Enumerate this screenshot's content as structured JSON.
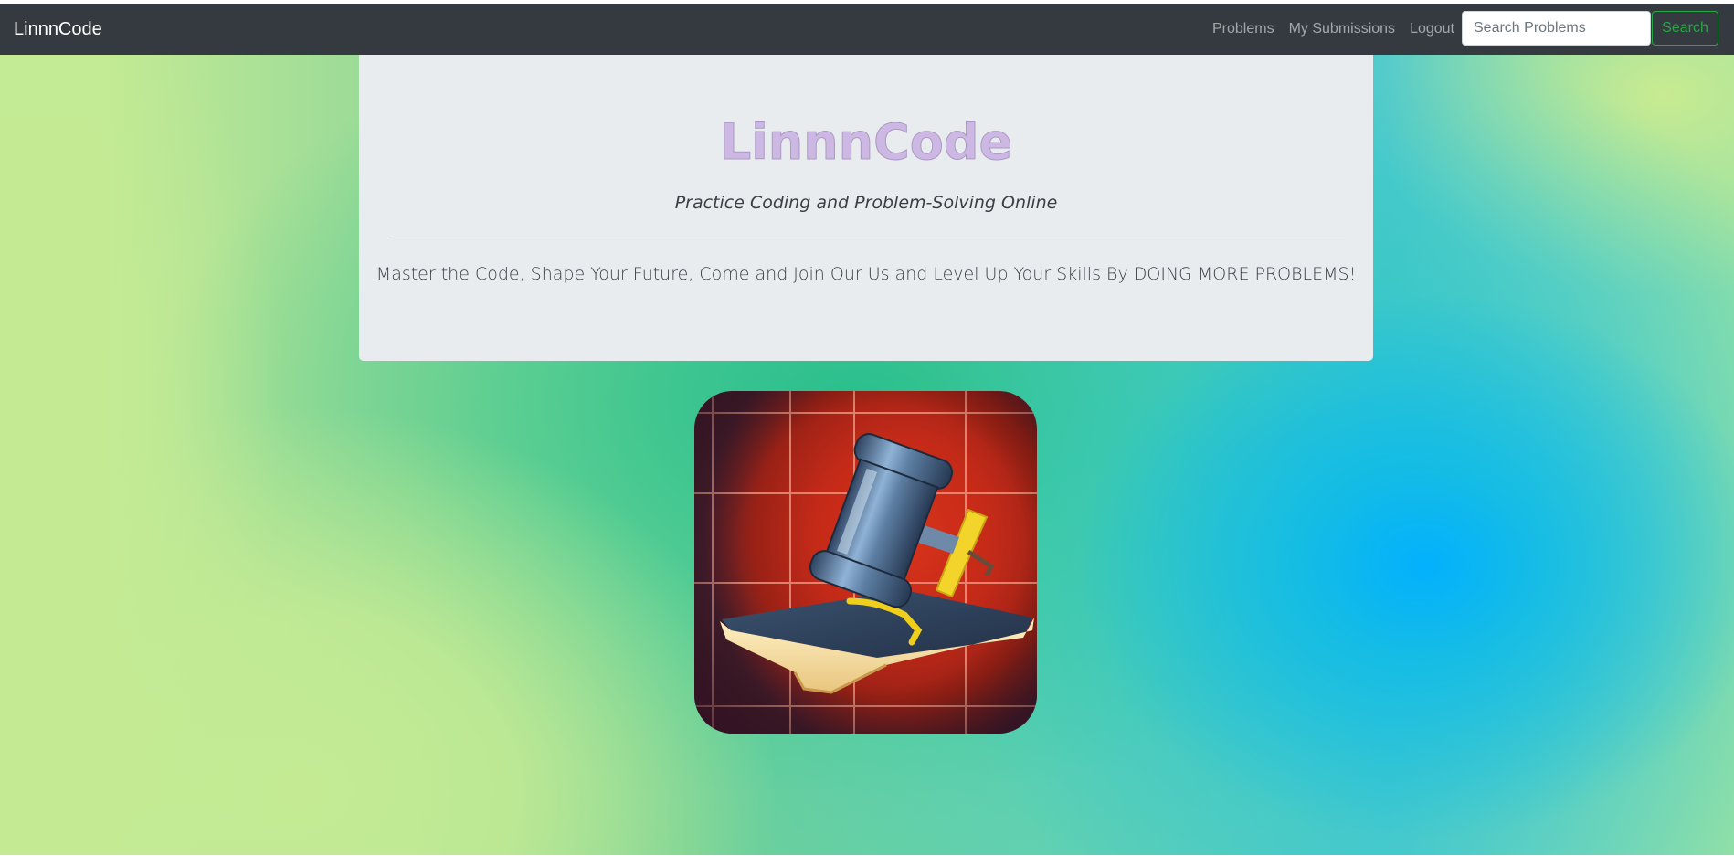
{
  "navbar": {
    "brand": "LinnnCode",
    "links": [
      {
        "label": "Problems"
      },
      {
        "label": "My Submissions"
      },
      {
        "label": "Logout"
      }
    ],
    "search": {
      "placeholder": "Search Problems",
      "value": "",
      "button_label": "Search"
    }
  },
  "hero": {
    "title": "LinnnCode",
    "subtitle": "Practice Coding and Problem-Solving Online",
    "lead": "Master the Code, Shape Your Future, Come and Join Our Us and Level Up Your Skills By DOING MORE PROBLEMS!"
  },
  "logo": {
    "icon": "gavel-on-book-icon"
  },
  "colors": {
    "navbar_bg": "#343a40",
    "search_accent": "#28a745",
    "title_color": "#cdb8e4",
    "jumbotron_bg": "#e9ecef"
  }
}
